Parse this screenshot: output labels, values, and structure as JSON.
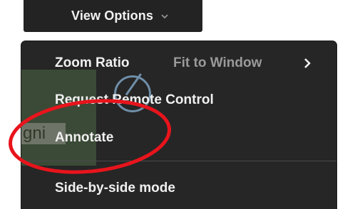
{
  "toolbar": {
    "view_options_label": "View Options",
    "chevron_icon": "chevron-down-icon"
  },
  "menu": {
    "items": [
      {
        "label": "Zoom Ratio",
        "value": "Fit to Window",
        "icon": "chevron-right-icon"
      },
      {
        "label": "Request Remote Control"
      },
      {
        "label": "Annotate"
      },
      {
        "label": "Side-by-side mode"
      }
    ]
  },
  "background": {
    "partial_text": "gni"
  },
  "colors": {
    "menu_bg": "#262626",
    "menu_text": "#f0f0f0",
    "secondary_text": "#9a9a9a",
    "annotation": "#e8141c"
  }
}
